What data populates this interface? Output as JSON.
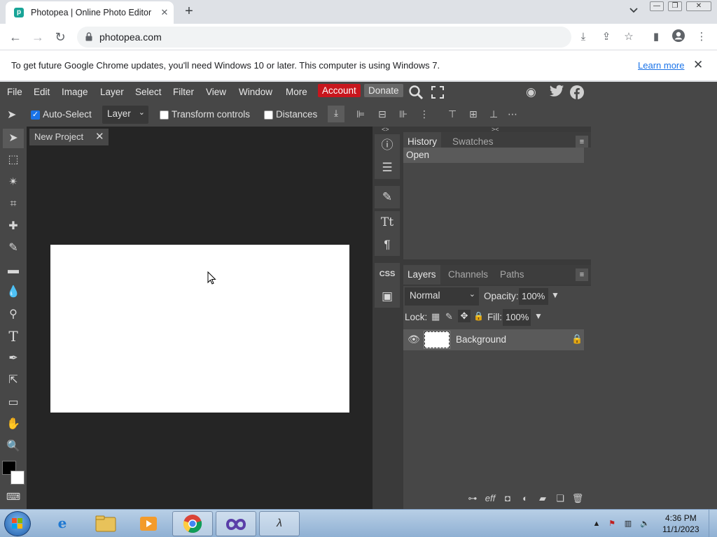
{
  "browser": {
    "tab_title": "Photopea | Online Photo Editor",
    "tab_favicon": "photopea-favicon",
    "url": "photopea.com"
  },
  "infobar": {
    "message": "To get future Google Chrome updates, you'll need Windows 10 or later. This computer is using Windows 7.",
    "link": "Learn more"
  },
  "photopea": {
    "menu": [
      "File",
      "Edit",
      "Image",
      "Layer",
      "Select",
      "Filter",
      "View",
      "Window",
      "More"
    ],
    "account_label": "Account",
    "donate_label": "Donate",
    "options": {
      "auto_select_label": "Auto-Select",
      "auto_select_checked": true,
      "target_value": "Layer",
      "transform_controls_label": "Transform controls",
      "distances_label": "Distances"
    },
    "document_tab": "New Project",
    "history_panel": {
      "tabs": [
        "History",
        "Swatches"
      ],
      "entries": [
        "Open"
      ]
    },
    "layers_panel": {
      "tabs": [
        "Layers",
        "Channels",
        "Paths"
      ],
      "blend_mode": "Normal",
      "opacity_label": "Opacity:",
      "opacity_value": "100%",
      "lock_label": "Lock:",
      "fill_label": "Fill:",
      "fill_value": "100%",
      "layers": [
        {
          "name": "Background"
        }
      ],
      "footer_eff": "eff"
    },
    "colors": {
      "accent_account": "#c8161d",
      "foreground": "#000000",
      "background": "#ffffff"
    }
  },
  "taskbar": {
    "time": "4:36 PM",
    "date": "11/1/2023"
  }
}
